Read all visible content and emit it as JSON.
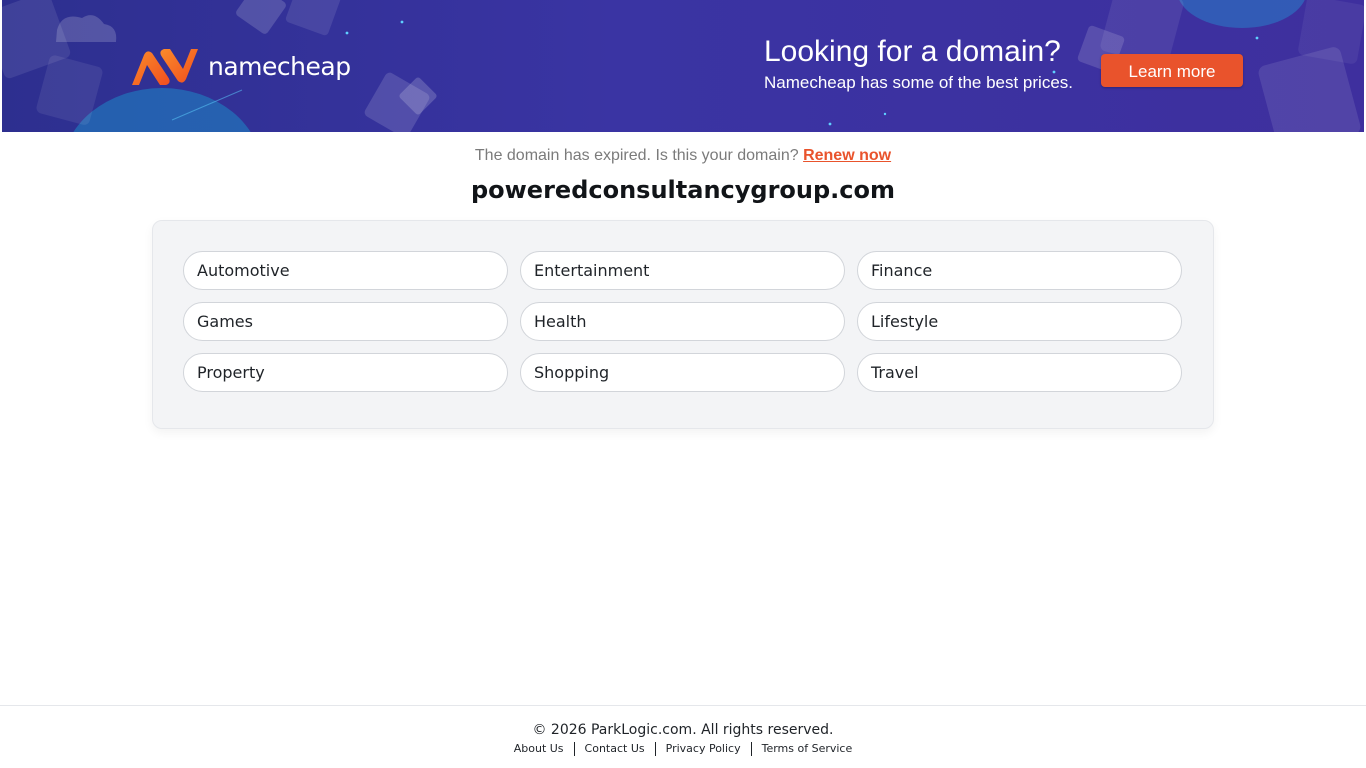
{
  "banner": {
    "logo_text": "namecheap",
    "title": "Looking for a domain?",
    "subtitle": "Namecheap has some of the best prices.",
    "cta_label": "Learn more",
    "background_color": "#3a34a3",
    "cta_color": "#e9532c",
    "logo_colors": [
      "#f46a24",
      "#fb8b2a"
    ]
  },
  "notice": {
    "text": "The domain has expired. Is this your domain?",
    "renew_label": "Renew now",
    "link_color": "#e9532c"
  },
  "domain_name": "poweredconsultancygroup.com",
  "categories": [
    {
      "label": "Automotive"
    },
    {
      "label": "Entertainment"
    },
    {
      "label": "Finance"
    },
    {
      "label": "Games"
    },
    {
      "label": "Health"
    },
    {
      "label": "Lifestyle"
    },
    {
      "label": "Property"
    },
    {
      "label": "Shopping"
    },
    {
      "label": "Travel"
    }
  ],
  "footer": {
    "copyright": "© 2026 ParkLogic.com. All rights reserved.",
    "links": [
      {
        "label": "About Us"
      },
      {
        "label": "Contact Us"
      },
      {
        "label": "Privacy Policy"
      },
      {
        "label": "Terms of Service"
      }
    ]
  }
}
